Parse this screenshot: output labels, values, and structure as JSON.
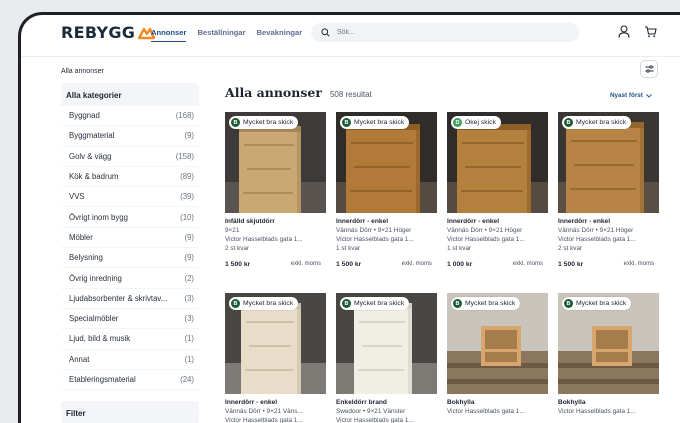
{
  "header": {
    "logo": "REBYGG",
    "nav": [
      "Annonser",
      "Beställningar",
      "Bevakningar"
    ],
    "search_placeholder": "Sök..."
  },
  "breadcrumb": "Alla annonser",
  "sidebar": {
    "title": "Alla kategorier",
    "items": [
      {
        "label": "Byggnad",
        "count": "(168)"
      },
      {
        "label": "Byggmaterial",
        "count": "(9)"
      },
      {
        "label": "Golv & vägg",
        "count": "(158)"
      },
      {
        "label": "Kök & badrum",
        "count": "(89)"
      },
      {
        "label": "VVS",
        "count": "(39)"
      },
      {
        "label": "Övrigt inom bygg",
        "count": "(10)"
      },
      {
        "label": "Möbler",
        "count": "(9)"
      },
      {
        "label": "Belysning",
        "count": "(9)"
      },
      {
        "label": "Övrig inredning",
        "count": "(2)"
      },
      {
        "label": "Ljudabsorbenter & skrivtav...",
        "count": "(3)"
      },
      {
        "label": "Specialmöbler",
        "count": "(3)"
      },
      {
        "label": "Ljud, bild & musik",
        "count": "(1)"
      },
      {
        "label": "Annat",
        "count": "(1)"
      },
      {
        "label": "Etableringsmaterial",
        "count": "(24)"
      }
    ],
    "filter_title": "Filter"
  },
  "main": {
    "title": "Alla annonser",
    "result_count": "508 resultat",
    "sort_label": "Nyast först"
  },
  "cards": [
    {
      "badge_letter": "B",
      "badge": "Mycket bra skick",
      "badge_color": "#1d5a35",
      "title": "Infälld skjutdörr",
      "line1": "9×21",
      "line2": "Victor Hasselblads gata 1...",
      "line3": "2 st kvar",
      "price": "1 500 kr",
      "vat": "exkl. moms"
    },
    {
      "badge_letter": "B",
      "badge": "Mycket bra skick",
      "badge_color": "#1d5a35",
      "title": "Innerdörr - enkel",
      "line1": "Vännäs Dörr • 9×21 Höger",
      "line2": "Victor Hasselblads gata 1...",
      "line3": "1 st kvar",
      "price": "1 500 kr",
      "vat": "exkl. moms"
    },
    {
      "badge_letter": "D",
      "badge": "Okej skick",
      "badge_color": "#3f9e5f",
      "title": "Innerdörr - enkel",
      "line1": "Vännäs Dörr • 9×21 Höger",
      "line2": "Victor Hasselblads gata 1...",
      "line3": "1 st kvar",
      "price": "1 000 kr",
      "vat": "exkl. moms"
    },
    {
      "badge_letter": "B",
      "badge": "Mycket bra skick",
      "badge_color": "#1d5a35",
      "title": "Innerdörr - enkel",
      "line1": "Vännäs Dörr • 9×21 Höger",
      "line2": "Victor Hasselblads gata 1...",
      "line3": "2 st kvar",
      "price": "1 500 kr",
      "vat": "exkl. moms"
    },
    {
      "badge_letter": "B",
      "badge": "Mycket bra skick",
      "badge_color": "#1d5a35",
      "title": "Innerdörr - enkel",
      "line1": "Vännäs Dörr • 9×21 Väns...",
      "line2": "Victor Hasselblads gata 1...",
      "line3": "",
      "price": "",
      "vat": ""
    },
    {
      "badge_letter": "B",
      "badge": "Mycket bra skick",
      "badge_color": "#1d5a35",
      "title": "Enkeldörr brand",
      "line1": "Swedoor • 9×21 Vänster",
      "line2": "Victor Hasselblads gata 1...",
      "line3": "",
      "price": "",
      "vat": ""
    },
    {
      "badge_letter": "B",
      "badge": "Mycket bra skick",
      "badge_color": "#1d5a35",
      "title": "Bokhylla",
      "line1": "",
      "line2": "Victor Hasselblads gata 1...",
      "line3": "",
      "price": "",
      "vat": ""
    },
    {
      "badge_letter": "B",
      "badge": "Mycket bra skick",
      "badge_color": "#1d5a35",
      "title": "Bokhylla",
      "line1": "",
      "line2": "Victor Hasselblads gata 1...",
      "line3": "",
      "price": "",
      "vat": ""
    }
  ],
  "colors": {
    "accent": "#1c4e89",
    "logo_orange": "#f08a24"
  },
  "icons": [
    "search-icon",
    "user-icon",
    "cart-icon",
    "filter-icon",
    "chevron-down-icon"
  ]
}
